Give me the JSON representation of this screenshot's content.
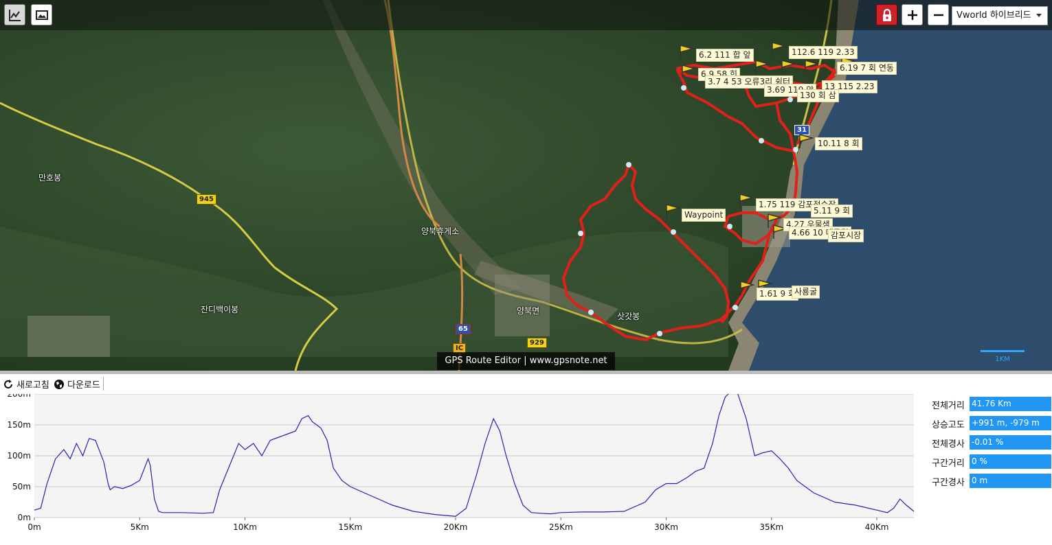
{
  "toolbar": {
    "chart_toggle_icon": "line-chart-icon",
    "image_toggle_icon": "image-icon",
    "lock_icon": "lock-icon",
    "zoom_in_icon": "plus-icon",
    "zoom_out_icon": "minus-icon",
    "map_type": "Vworld 하이브리드"
  },
  "map": {
    "places": [
      "만호봉",
      "잔디백이봉",
      "양북휴게소",
      "양북면",
      "삿갓봉",
      "Waypoint"
    ],
    "road_shields": [
      "945",
      "929",
      "65",
      "31",
      "IC"
    ],
    "waypoint_labels": [
      "6.2 111 합 앞",
      "112.6 119 2.33",
      "6.19 7 회 연동",
      "6.9 58 힌",
      "3.7 4 53 오류3리 쉼터",
      "3.69 119 앞",
      "13 115 2.23",
      "130 회 삼",
      "10.11 8 회",
      "1.75 119 감포정수장",
      "5.11 9 회",
      "4.27 우물샘",
      "4.66 10 대국길",
      "감포시장",
      "1.61 9 회",
      "사룡굴"
    ],
    "banner": "GPS Route Editor | www.gpsnote.net",
    "scale": "1KM"
  },
  "bottom_toolbar": {
    "refresh_label": "새로고침",
    "download_label": "다운로드"
  },
  "stats": {
    "total_distance_label": "전체거리",
    "total_distance_value": "41.76 Km",
    "ascent_label": "상승고도",
    "ascent_value": "+991 m, -979 m",
    "total_grade_label": "전체경사",
    "total_grade_value": "-0.01 %",
    "segment_distance_label": "구간거리",
    "segment_distance_value": "0 %",
    "segment_grade_label": "구간경사",
    "segment_grade_value": "0 m"
  },
  "colors": {
    "route": "#e0201a",
    "profile_line": "#2222b0",
    "stat_bg": "#2196f3",
    "lock_bg": "#cc2229"
  },
  "chart_data": {
    "type": "line",
    "x_unit": "Km",
    "x_tick_labels": [
      "0m",
      "5Km",
      "10Km",
      "15Km",
      "20Km",
      "25Km",
      "30Km",
      "35Km",
      "40Km"
    ],
    "y_tick_labels": [
      "0m",
      "50m",
      "100m",
      "150m",
      "200m"
    ],
    "xlim": [
      0,
      41.76
    ],
    "ylim": [
      0,
      200
    ],
    "grid": true,
    "series": [
      {
        "x": [
          0,
          0.3,
          0.6,
          1.0,
          1.4,
          1.7,
          2.0,
          2.3,
          2.6,
          2.9,
          3.3,
          3.5,
          3.6,
          3.8,
          4.2,
          4.6,
          5.0,
          5.4,
          5.5,
          5.7,
          5.9,
          6.1,
          6.3,
          7.0,
          8.0,
          8.5,
          8.8,
          9.1,
          9.4,
          9.7,
          10.0,
          10.4,
          10.8,
          11.2,
          11.6,
          12.0,
          12.4,
          12.7,
          13.0,
          13.2,
          13.6,
          13.9,
          14.2,
          14.6,
          15.0,
          16.0,
          17.0,
          18.0,
          19.0,
          20.0,
          20.5,
          21.0,
          21.4,
          21.8,
          22.1,
          22.4,
          22.8,
          23.2,
          23.6,
          24.0,
          24.5,
          25.0,
          26.0,
          27.0,
          28.0,
          29.0,
          29.5,
          30.0,
          30.5,
          31.0,
          31.4,
          31.8,
          32.2,
          32.5,
          32.8,
          33.1,
          33.4,
          33.8,
          34.2,
          34.6,
          35.0,
          35.4,
          35.8,
          36.2,
          37.0,
          38.0,
          39.0,
          40.0,
          40.5,
          40.8,
          41.1,
          41.4,
          41.76
        ],
        "y": [
          12,
          15,
          55,
          95,
          110,
          95,
          120,
          100,
          128,
          125,
          90,
          55,
          45,
          50,
          47,
          52,
          60,
          95,
          85,
          30,
          10,
          8,
          8,
          8,
          7,
          8,
          45,
          70,
          95,
          120,
          110,
          120,
          100,
          125,
          130,
          135,
          140,
          160,
          165,
          155,
          145,
          125,
          80,
          60,
          50,
          35,
          20,
          10,
          5,
          2,
          15,
          70,
          120,
          160,
          140,
          100,
          55,
          20,
          8,
          7,
          6,
          8,
          9,
          9,
          10,
          25,
          45,
          55,
          55,
          65,
          75,
          80,
          120,
          165,
          195,
          205,
          200,
          160,
          100,
          105,
          108,
          95,
          80,
          60,
          40,
          25,
          20,
          12,
          8,
          15,
          30,
          20,
          10
        ]
      }
    ]
  }
}
